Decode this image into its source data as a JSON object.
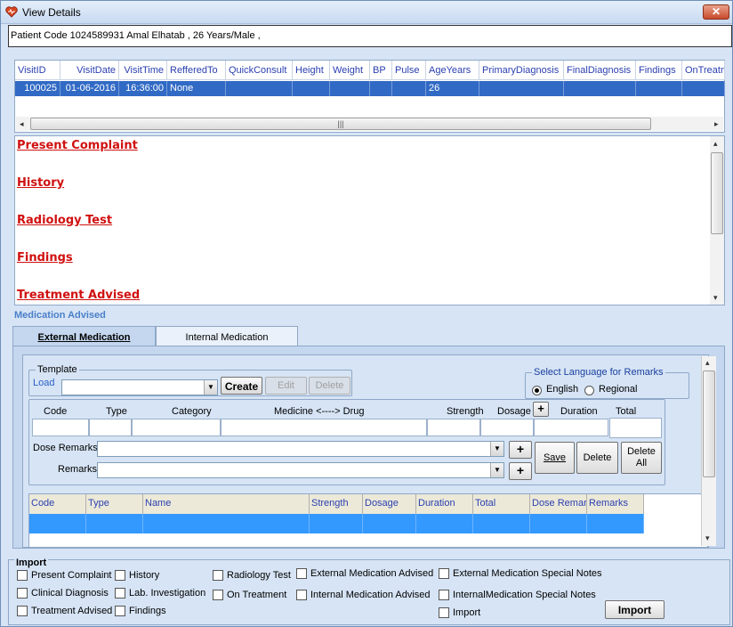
{
  "window": {
    "title": "View Details"
  },
  "patient": {
    "info": "Patient Code 1024589931 Amal Elhatab , 26 Years/Male      ,"
  },
  "visits": {
    "columns": [
      "VisitID",
      "VisitDate",
      "VisitTime",
      "RefferedTo",
      "QuickConsult",
      "Height",
      "Weight",
      "BP",
      "Pulse",
      "AgeYears",
      "PrimaryDiagnosis",
      "FinalDiagnosis",
      "Findings",
      "OnTreatm"
    ],
    "rows": [
      [
        "100025",
        "01-06-2016",
        "16:36:00",
        "None",
        "",
        "",
        "",
        "",
        "",
        "26",
        "",
        "",
        "",
        ""
      ]
    ]
  },
  "sections": [
    "Present Complaint",
    "History",
    "Radiology Test",
    "Findings",
    "Treatment Advised"
  ],
  "medication": {
    "title": "Medication Advised",
    "tabs": {
      "external": "External Medication",
      "internal": "Internal Medication"
    },
    "template": {
      "legend": "Template",
      "load_label": "Load",
      "create": "Create",
      "edit": "Edit",
      "delete": "Delete"
    },
    "language": {
      "legend": "Select Language for Remarks",
      "english": "English",
      "regional": "Regional",
      "selected": "English"
    },
    "form_headers": {
      "code": "Code",
      "type": "Type",
      "category": "Category",
      "medicine": "Medicine <----> Drug",
      "strength": "Strength",
      "dosage": "Dosage",
      "duration": "Duration",
      "total": "Total"
    },
    "dose_remarks_label": "Dose Remarks",
    "remarks_label": "Remarks",
    "plus": "+",
    "buttons": {
      "save": "Save",
      "delete": "Delete",
      "delete_all_1": "Delete",
      "delete_all_2": "All"
    },
    "list_columns": [
      "Code",
      "Type",
      "Name",
      "Strength",
      "Dosage",
      "Duration",
      "Total",
      "Dose Remar",
      "Remarks"
    ]
  },
  "import": {
    "legend": "Import",
    "options": [
      "Present Complaint",
      "History",
      "Radiology Test",
      "External Medication Advised",
      "External Medication Special Notes",
      "Clinical Diagnosis",
      "Lab. Investigation",
      "On Treatment",
      "Internal Medication Advised",
      "InternalMedication Special Notes",
      "Treatment Advised",
      "Findings",
      "Import"
    ],
    "button": "Import"
  },
  "colors": {
    "accent": "#316ac5",
    "link_red": "#d01010",
    "header_blue": "#2a3fb0"
  },
  "icons": {
    "close": "close-icon",
    "app": "heart-app-icon"
  }
}
